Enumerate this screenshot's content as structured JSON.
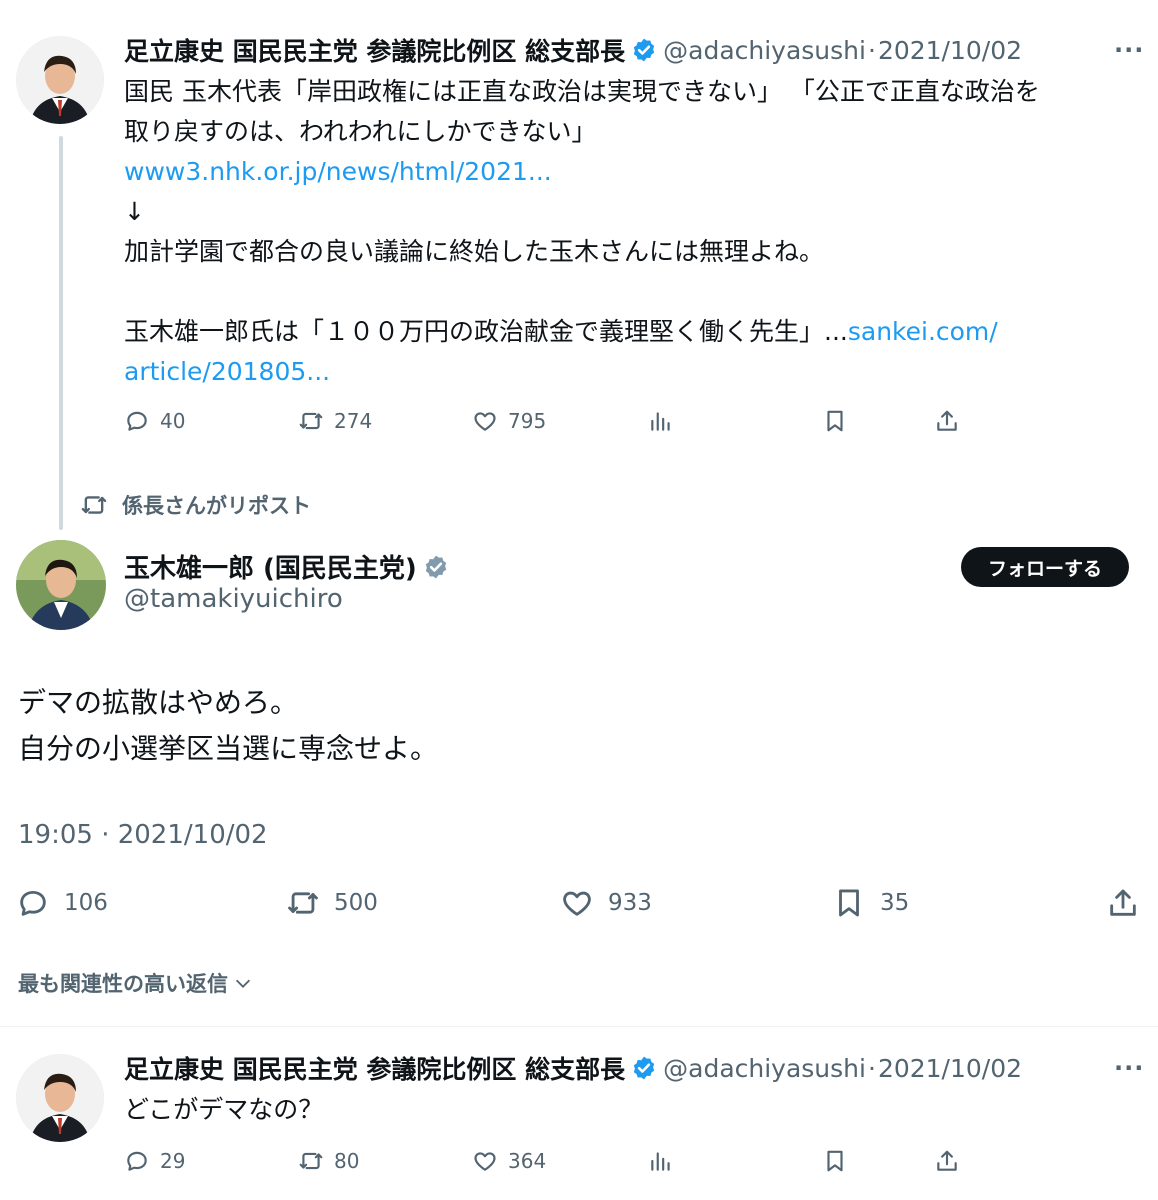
{
  "tweet1": {
    "name": "足立康史 国民民主党 参議院比例区 総支部長",
    "handle": "@adachiyasushi",
    "separator": "·",
    "date": "2021/10/02",
    "more": "···",
    "line1": "国民 玉木代表「岸田政権には正直な政治は実現できない」 「公正で正直な政治を",
    "line2": "取り戻すのは、われわれにしかできない」",
    "link1": "www3.nhk.or.jp/news/html/2021...",
    "arrow": "↓",
    "line4": "加計学園で都合の良い議論に終始した玉木さんには無理よね。",
    "line5_text": "玉木雄一郎氏は「１００万円の政治献金で義理堅く働く先生」...",
    "line5_link": "sankei.com/",
    "link2": "article/201805...",
    "replies": "40",
    "reposts": "274",
    "likes": "795"
  },
  "repost_note": "係長さんがリポスト",
  "main_tweet": {
    "name": "玉木雄一郎 (国民民主党)",
    "handle": "@tamakiyuichiro",
    "follow_label": "フォローする",
    "line1": "デマの拡散はやめろ。",
    "line2": "自分の小選挙区当選に専念せよ。",
    "timestamp": "19:05 · 2021/10/02",
    "replies": "106",
    "reposts": "500",
    "likes": "933",
    "bookmarks": "35"
  },
  "replies_sort": "最も関連性の高い返信",
  "reply": {
    "name": "足立康史 国民民主党 参議院比例区 総支部長",
    "handle": "@adachiyasushi",
    "separator": "·",
    "date": "2021/10/02",
    "more": "···",
    "text": "どこがデマなの？",
    "replies": "29",
    "reposts": "80",
    "likes": "364"
  },
  "colors": {
    "link": "#1d9bf0",
    "verified": "#1d9bf0",
    "verified_gray": "#829aab",
    "secondary_text": "#536471",
    "follow_button": "#0f1419"
  }
}
